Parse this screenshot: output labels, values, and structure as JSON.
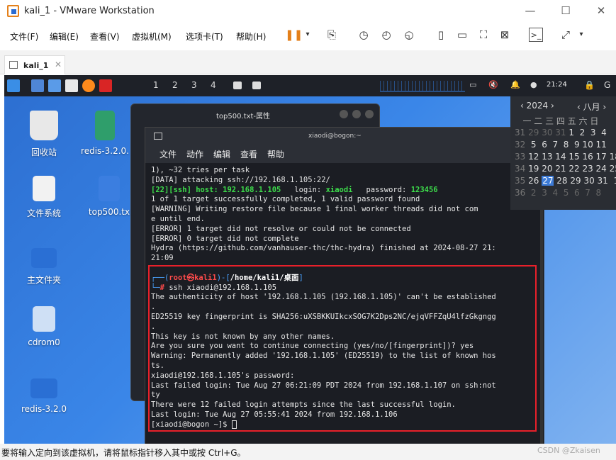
{
  "window": {
    "title": "kali_1 - VMware Workstation",
    "min": "—",
    "max": "☐",
    "close": "✕"
  },
  "menubar": [
    "文件(F)",
    "编辑(E)",
    "查看(V)",
    "虚拟机(M)",
    "选项卡(T)",
    "帮助(H)"
  ],
  "tab": {
    "label": "kali_1",
    "close": "✕"
  },
  "panel": {
    "workspaces": [
      "1",
      "2",
      "3",
      "4"
    ],
    "clock": "21:24"
  },
  "desktop_icons": [
    {
      "label": "回收站",
      "color": "#e8e8e8"
    },
    {
      "label": "redis-3.2.0.",
      "color": "#2f9e6b"
    },
    {
      "label": "文件系统",
      "color": "#f2f2f2"
    },
    {
      "label": "top500.tx",
      "color": "#3b7ee0"
    },
    {
      "label": "主文件夹",
      "color": "#2a6fd4"
    },
    {
      "label": "cdrom0",
      "color": "#cfe0f5"
    },
    {
      "label": "redis-3.2.0",
      "color": "#2a6fd4"
    }
  ],
  "props_title": "top500.txt-属性",
  "terminal": {
    "title": "xiaodi@bogon:~",
    "menu": [
      "文件",
      "动作",
      "编辑",
      "查看",
      "帮助"
    ],
    "hydra": {
      "l1": "1), ~32 tries per task",
      "l2": "[DATA] attacking ssh://192.168.1.105:22/",
      "l3a": "[22][ssh] host: ",
      "l3host": "192.168.1.105",
      "l3b": "   login: ",
      "l3login": "xiaodi",
      "l3c": "   password: ",
      "l3pass": "123456",
      "l4": "1 of 1 target successfully completed, 1 valid password found",
      "l5": "[WARNING] Writing restore file because 1 final worker threads did not com",
      "l6": "e until end.",
      "l7": "[ERROR] 1 target did not resolve or could not be connected",
      "l8": "[ERROR] 0 target did not complete",
      "l9": "Hydra (https://github.com/vanhauser-thc/thc-hydra) finished at 2024-08-27 21:",
      "l10": "21:09"
    },
    "prompt": {
      "a": "┌──(",
      "user": "root㉿kali1",
      "b": ")-[",
      "path": "/home/kali1/桌面",
      "c": "]",
      "d": "└─",
      "hash": "# ",
      "cmd": "ssh xiaodi@192.168.1.105"
    },
    "ssh": [
      "The authenticity of host '192.168.1.105 (192.168.1.105)' can't be established",
      ".",
      "ED25519 key fingerprint is SHA256:uXSBKKUIkcxSOG7K2Dps2NC/ejqVFFZqU4lfzGkgngg",
      ".",
      "This key is not known by any other names.",
      "Are you sure you want to continue connecting (yes/no/[fingerprint])? yes",
      "Warning: Permanently added '192.168.1.105' (ED25519) to the list of known hos",
      "ts.",
      "xiaodi@192.168.1.105's password:",
      "Last failed login: Tue Aug 27 06:21:09 PDT 2024 from 192.168.1.107 on ssh:not",
      "ty",
      "There were 12 failed login attempts since the last successful login.",
      "Last login: Tue Aug 27 05:55:41 2024 from 192.168.1.106",
      "[xiaodi@bogon ~]$ "
    ]
  },
  "calendar": {
    "year": "‹ 2024 ›",
    "month": "‹  八月  ›",
    "weekdays": "   一 二 三 四 五 六 日",
    "rows": [
      {
        "wk": "31",
        "days": "29 30 31",
        "cur": " 1  2  3  4"
      },
      {
        "wk": "32",
        "days": "",
        "cur": " 5  6  7  8  9 10 11"
      },
      {
        "wk": "33",
        "days": "",
        "cur": "12 13 14 15 16 17 18"
      },
      {
        "wk": "34",
        "days": "",
        "cur": "19 20 21 22 23 24 25"
      },
      {
        "wk": "35",
        "days": "",
        "cur": "26 "
      },
      {
        "wk": "36",
        "days": " 2  3  4  5  6  7  8",
        "cur": ""
      }
    ],
    "today": "27",
    "rest35": " 28 29 30 31  1"
  },
  "statusbar": {
    "message": "要将输入定向到该虚拟机，请将鼠标指针移入其中或按 Ctrl+G。",
    "watermark": "CSDN @Zkaisen"
  }
}
